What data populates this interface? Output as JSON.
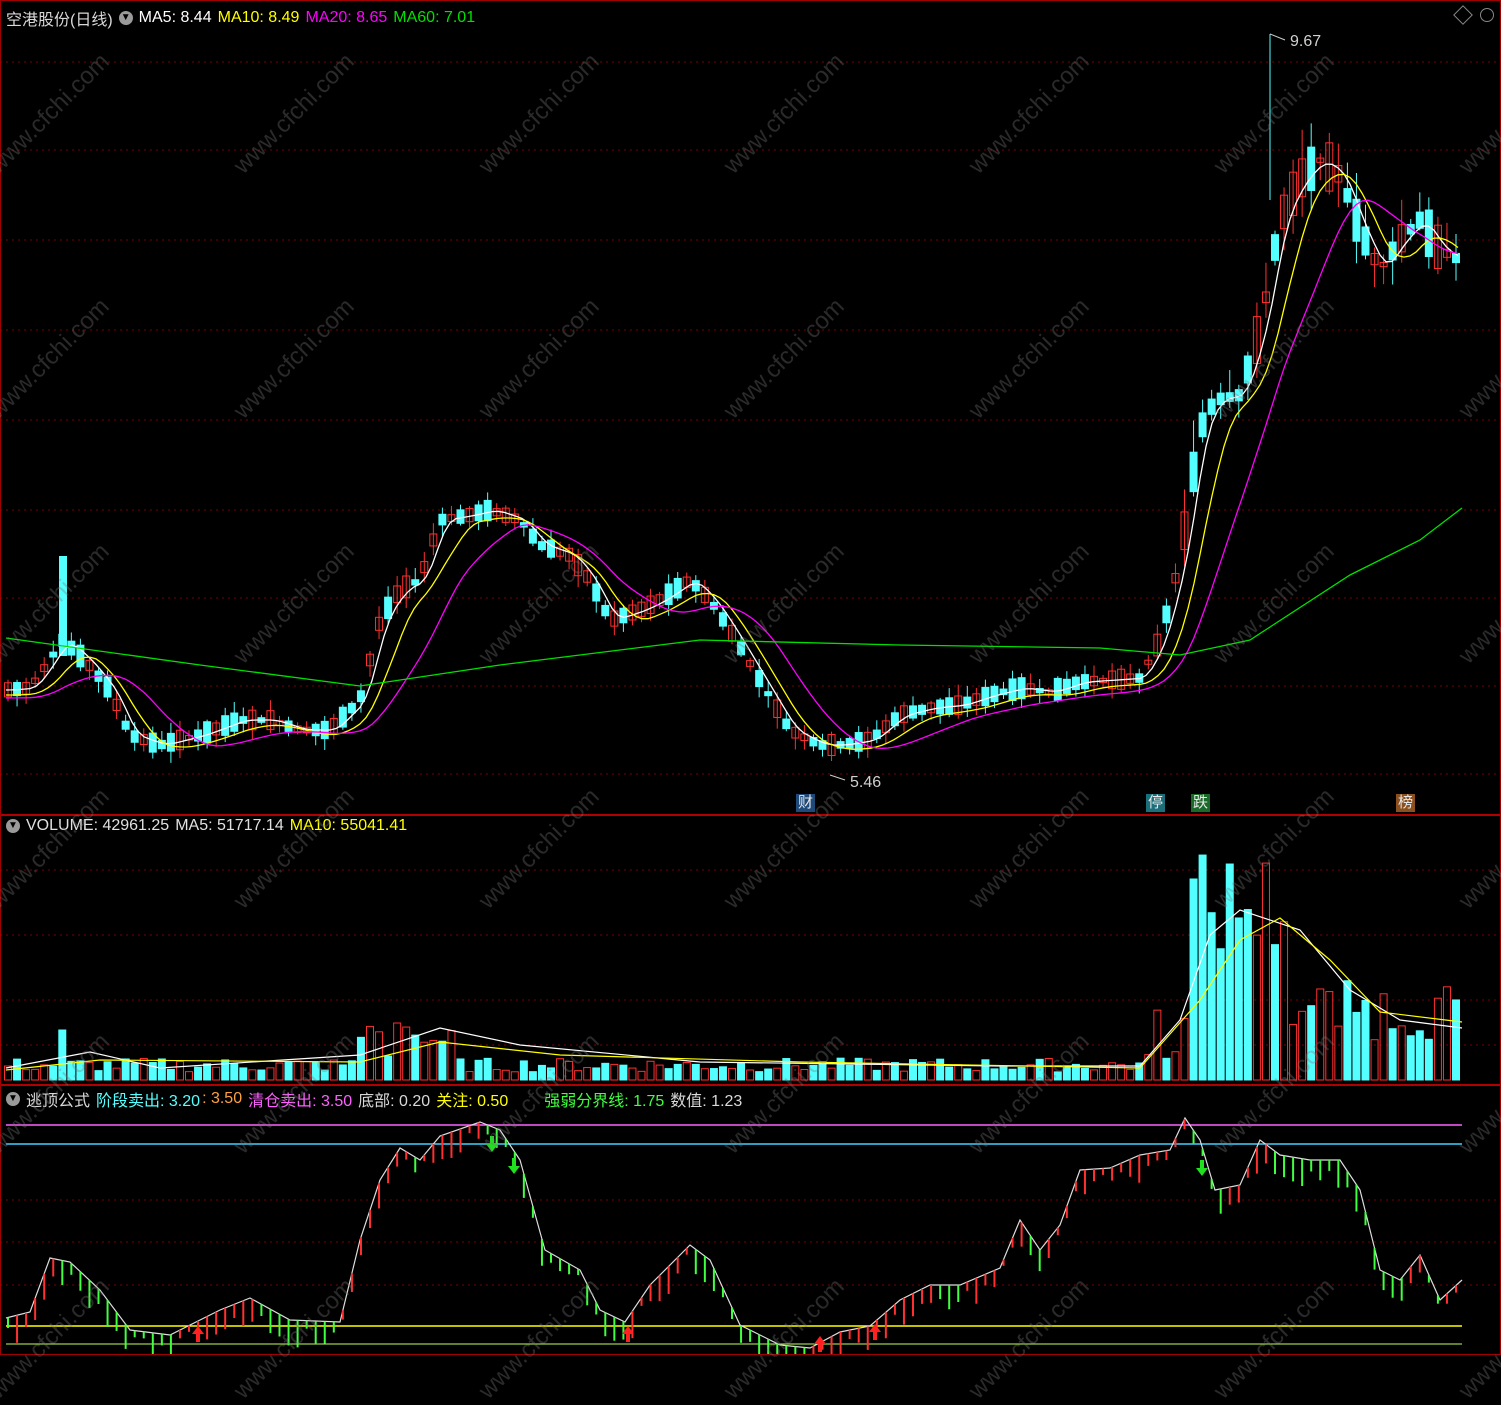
{
  "main_panel": {
    "title": "空港股份(日线)",
    "ma5_label": "MA5: 8.44",
    "ma10_label": "MA10: 8.49",
    "ma20_label": "MA20: 8.65",
    "ma60_label": "MA60: 7.01",
    "high_label": "9.67",
    "low_label": "5.46",
    "tags": [
      {
        "text": "财",
        "color": "#1e4a7a"
      },
      {
        "text": "停",
        "color": "#1a6f7a"
      },
      {
        "text": "跌",
        "color": "#1a6a2a"
      },
      {
        "text": "榜",
        "color": "#8a5020"
      }
    ]
  },
  "volume_panel": {
    "volume_label": "VOLUME: 42961.25",
    "ma5_label": "MA5: 51717.14",
    "ma10_label": "MA10: 55041.41"
  },
  "indicator_panel": {
    "title": "逃顶公式",
    "stage_sell_label": "阶段卖出: 3.20",
    "stage_sell_value2": ": 3.50",
    "clear_sell_label": "清仓卖出: 3.50",
    "bottom_label": "底部: 0.20",
    "watch_label": "关注: 0.50",
    "divider_label": "强弱分界线: 1.75",
    "value_label": "数值: 1.23"
  },
  "watermark": "www.cfchi.com",
  "colors": {
    "up": "#ff3030",
    "down": "#54ffff",
    "ma5": "#ffffff",
    "ma10": "#ffff00",
    "ma20": "#ff00ff",
    "ma60": "#00e000",
    "grid": "#7a0000"
  }
}
